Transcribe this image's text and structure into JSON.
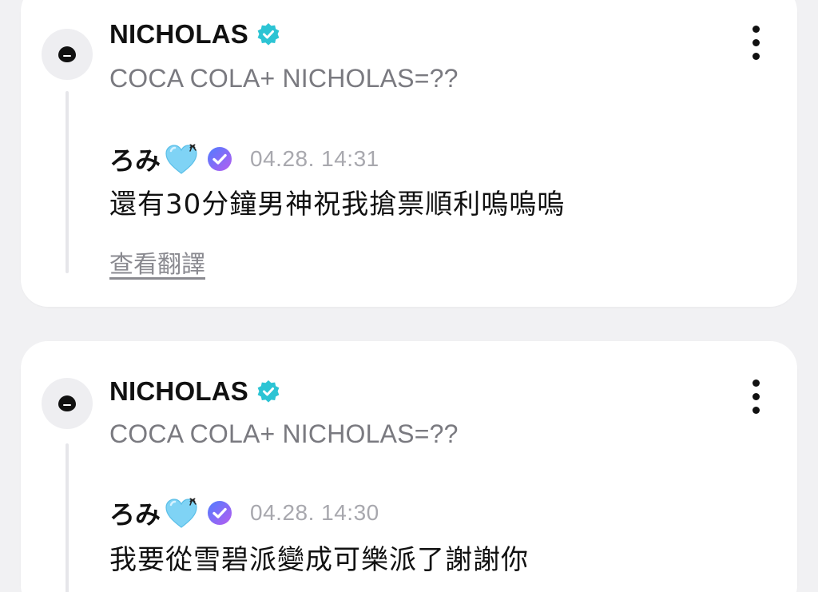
{
  "posts": [
    {
      "artist": "NICHOLAS",
      "quote": "COCA COLA+ NICHOLAS=??",
      "reply": {
        "name": "ろみ",
        "time": "04.28. 14:31",
        "text": "還有30分鐘男神祝我搶票順利嗚嗚嗚",
        "translate_label": "查看翻譯"
      }
    },
    {
      "artist": "NICHOLAS",
      "quote": "COCA COLA+ NICHOLAS=??",
      "reply": {
        "name": "ろみ",
        "time": "04.28. 14:30",
        "text": "我要從雪碧派變成可樂派了謝謝你"
      }
    }
  ],
  "icons": {
    "avatar": "chat-bubble-icon",
    "verified": "verified-badge-icon",
    "heart": "light-blue-heart-icon",
    "fan_badge": "fan-check-badge-icon",
    "more": "more-vertical-icon"
  },
  "colors": {
    "verified": "#2cc4d4",
    "heart": "#7fd3f5",
    "fan_badge_start": "#4f7dff",
    "fan_badge_end": "#b65cf0"
  }
}
